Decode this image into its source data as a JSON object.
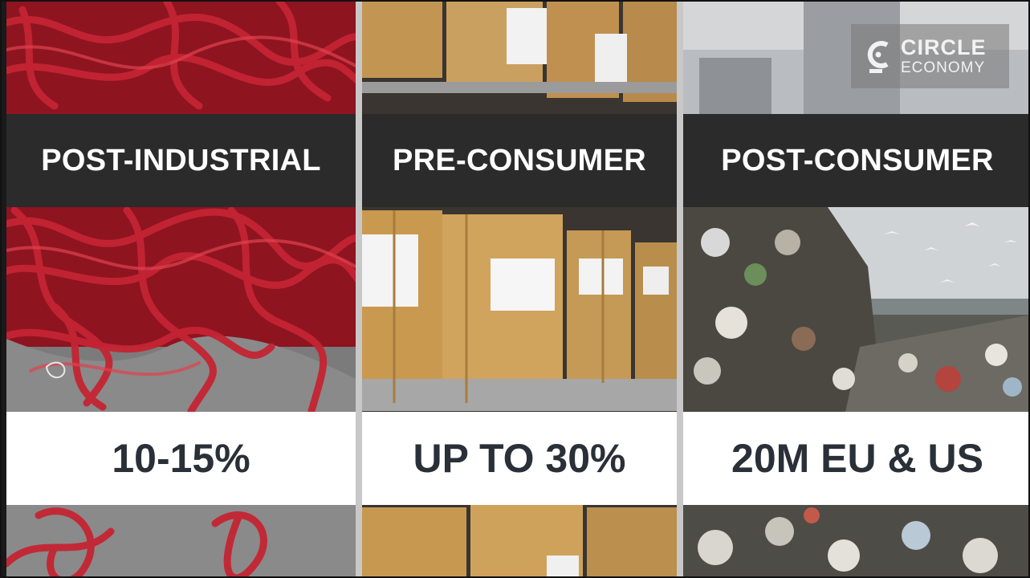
{
  "panels": [
    {
      "heading": "POST-INDUSTRIAL",
      "figure": "10-15%",
      "photo": "red-textile-scraps"
    },
    {
      "heading": "PRE-CONSUMER",
      "figure": "UP TO 30%",
      "photo": "cardboard-boxes-on-shelves"
    },
    {
      "heading": "POST-CONSUMER",
      "figure": "20M EU & US",
      "photo": "landfill-waste"
    }
  ],
  "logo": {
    "line1": "CIRCLE",
    "line2": "ECONOMY",
    "icon": "circle-economy-logo-icon"
  },
  "colors": {
    "dark_band": "#2b2b2b",
    "white_band": "#ffffff",
    "figure_text": "#2a3038",
    "heading_text": "#ffffff",
    "textile_red": "#b51d2a",
    "cardboard": "#c89a5a"
  }
}
